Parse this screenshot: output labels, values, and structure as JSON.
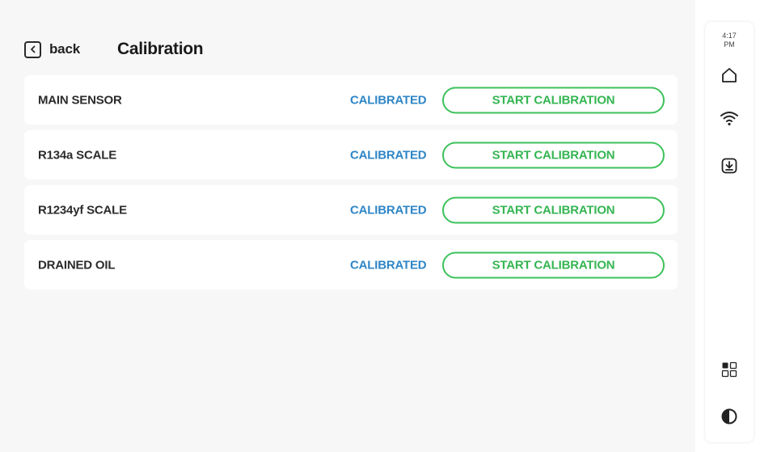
{
  "header": {
    "back_label": "back",
    "title": "Calibration"
  },
  "rows": [
    {
      "name": "MAIN SENSOR",
      "status": "CALIBRATED",
      "action": "START CALIBRATION"
    },
    {
      "name": "R134a SCALE",
      "status": "CALIBRATED",
      "action": "START CALIBRATION"
    },
    {
      "name": "R1234yf SCALE",
      "status": "CALIBRATED",
      "action": "START CALIBRATION"
    },
    {
      "name": "DRAINED OIL",
      "status": "CALIBRATED",
      "action": "START CALIBRATION"
    }
  ],
  "sidebar": {
    "time": "4:17",
    "ampm": "PM",
    "icons": [
      "home-icon",
      "wifi-icon",
      "download-icon",
      "apps-grid-icon",
      "contrast-icon"
    ]
  },
  "colors": {
    "status": "#2f86c6",
    "button_border": "#3cc25a",
    "button_text": "#35b552",
    "background": "#f7f7f8"
  }
}
